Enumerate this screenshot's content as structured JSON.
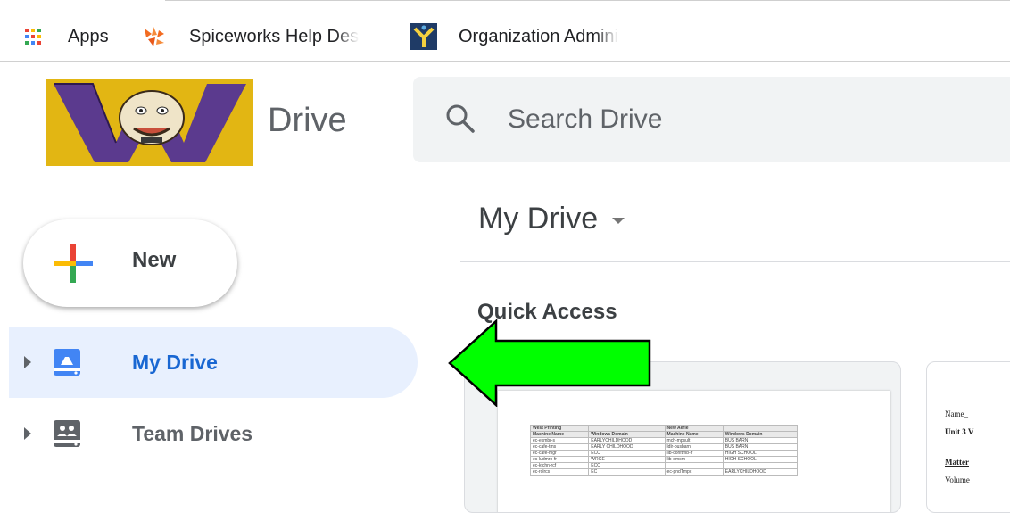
{
  "bookmarks": {
    "items": [
      {
        "label": "Apps",
        "icon": "apps-grid-icon"
      },
      {
        "label": "Spiceworks Help Des",
        "icon": "spiceworks-icon"
      },
      {
        "label": "Organization Admini",
        "icon": "organization-icon"
      }
    ]
  },
  "header": {
    "app_name": "Drive",
    "search": {
      "placeholder": "Search Drive"
    }
  },
  "sidebar": {
    "new_label": "New",
    "items": [
      {
        "label": "My Drive",
        "icon": "my-drive-icon",
        "selected": true
      },
      {
        "label": "Team Drives",
        "icon": "team-drives-icon",
        "selected": false
      }
    ]
  },
  "main": {
    "title": "My Drive",
    "quick_access_title": "Quick Access",
    "quick_access_files": [
      {
        "thumbnail": "spreadsheet",
        "sheet": {
          "group_headers": [
            "West Printing",
            "",
            "New Aerie",
            ""
          ],
          "columns": [
            "Machine Name",
            "Windows Domain",
            "Machine Name",
            "Windows Domain"
          ],
          "rows": [
            [
              "ec-ekmbr-s",
              "EARLYCHILDHOOD",
              "mch-mpsult",
              "BUS BARN"
            ],
            [
              "ec-cafe-tms",
              "EARLY CHILDHOOD",
              "ldlr-busbarn",
              "BUS BARN"
            ],
            [
              "ec-cafe-mgr",
              "ECC",
              "lib-conftmb-lr",
              "HIGH SCHOOL"
            ],
            [
              "ec-ludmrn-fr",
              "WRGE",
              "lib-dmcrn",
              "HIGH SCHOOL"
            ],
            [
              "ec-ktchn-rcf",
              "ECC",
              "",
              ""
            ],
            [
              "ec-rolrcs",
              "EC",
              "ec-pndTmpc",
              "EARLYCHILDHOOD"
            ]
          ]
        }
      },
      {
        "thumbnail": "document",
        "lines": [
          "Name_",
          "Unit 3 V",
          "Matter",
          "Volume"
        ]
      }
    ]
  },
  "colors": {
    "selected_nav_bg": "#e8f0fe",
    "selected_nav_text": "#1967d2",
    "annotation_arrow": "#00ff00",
    "logo_gold": "#e2b613",
    "logo_purple": "#5b3a8e"
  }
}
